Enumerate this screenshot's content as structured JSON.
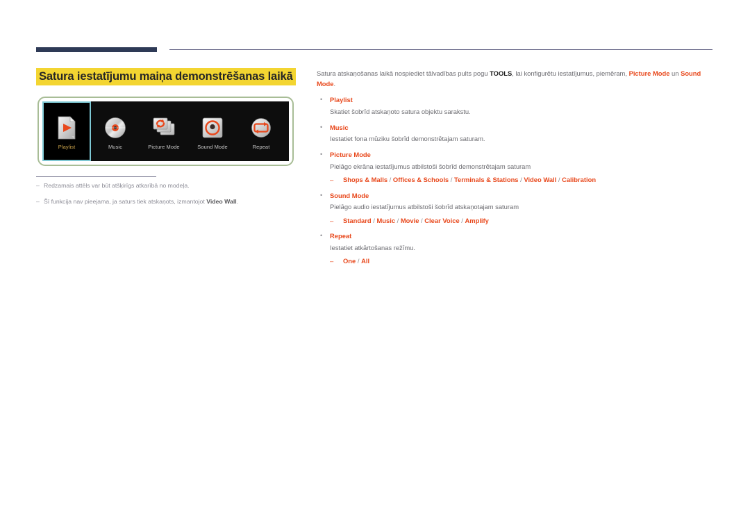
{
  "title": "Satura iestatījumu maiņa demonstrēšanas laikā",
  "colors": {
    "accent": "#e8481c",
    "highlight": "#f3d531",
    "rule_dark": "#2e3a56",
    "panel_border": "#a8bd96",
    "selected_border": "#7ec8d4",
    "selected_label": "#caa24a"
  },
  "panel": {
    "tiles": [
      {
        "icon": "playlist-document-play-icon",
        "label": "Playlist",
        "selected": true
      },
      {
        "icon": "music-disc-icon",
        "label": "Music",
        "selected": false
      },
      {
        "icon": "picture-mode-images-refresh-icon",
        "label": "Picture Mode",
        "selected": false
      },
      {
        "icon": "sound-mode-speaker-ring-icon",
        "label": "Sound Mode",
        "selected": false
      },
      {
        "icon": "repeat-loop-icon",
        "label": "Repeat",
        "selected": false
      }
    ]
  },
  "notes": [
    {
      "dash": "‒",
      "text_before": "Redzamais attēls var būt atšķirīgs atkarībā no modeļa.",
      "bold": "",
      "text_after": ""
    },
    {
      "dash": "‒",
      "text_before": "Šī funkcija nav pieejama, ja saturs tiek atskaņots, izmantojot ",
      "bold": "Video Wall",
      "text_after": "."
    }
  ],
  "intro": {
    "p1": "Satura atskaņošanas laikā nospiediet tālvadības pults pogu ",
    "tools": "TOOLS",
    "p2": ", lai konfigurētu iestatījumus, piemēram, ",
    "picture_mode": "Picture Mode",
    "p3": " un ",
    "sound_mode": "Sound Mode",
    "p4": "."
  },
  "bullets": [
    {
      "marker": "•",
      "head": "Playlist",
      "desc": "Skatiet šobrīd atskaņoto satura objektu sarakstu.",
      "sub_dash": "",
      "options": []
    },
    {
      "marker": "•",
      "head": "Music",
      "desc": "Iestatiet fona mūziku šobrīd demonstrētajam saturam.",
      "sub_dash": "",
      "options": []
    },
    {
      "marker": "•",
      "head": "Picture Mode",
      "desc": "Pielāgo ekrāna iestatījumus atbilstoši šobrīd demonstrētajam saturam",
      "sub_dash": "‒",
      "options": [
        "Shops & Malls",
        "Offices & Schools",
        "Terminals & Stations",
        "Video Wall",
        "Calibration"
      ]
    },
    {
      "marker": "•",
      "head": "Sound Mode",
      "desc": "Pielāgo audio iestatījumus atbilstoši šobrīd atskaņotajam saturam",
      "sub_dash": "‒",
      "options": [
        "Standard",
        "Music",
        "Movie",
        "Clear Voice",
        "Amplify"
      ]
    },
    {
      "marker": "•",
      "head": "Repeat",
      "desc": "Iestatiet atkārtošanas režīmu.",
      "sub_dash": "‒",
      "options": [
        "One",
        "All"
      ]
    }
  ]
}
